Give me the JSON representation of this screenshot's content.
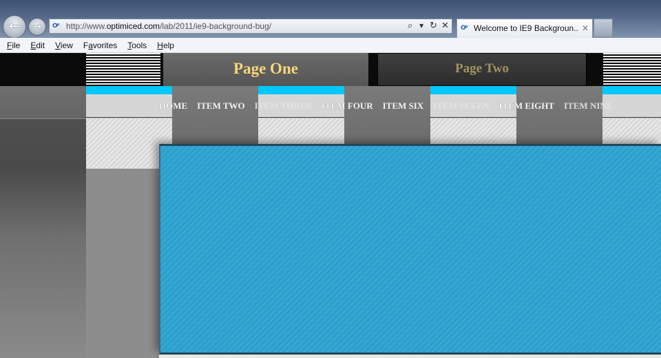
{
  "browser": {
    "address": {
      "prefix": "http://www.",
      "domain": "optimiced.com",
      "path": "/lab/2011/ie9-background-bug/"
    },
    "tab": {
      "title": "Welcome to IE9 Backgroun...",
      "close": "✕"
    },
    "icons": {
      "back": "back-arrow-icon",
      "forward": "forward-arrow-icon",
      "search": "search-icon",
      "refresh": "refresh-icon",
      "stop": "stop-icon",
      "favicon": "ie-page-icon"
    },
    "page_icon_glyph": "O̲",
    "menu": [
      {
        "pre": "",
        "acc": "F",
        "post": "ile"
      },
      {
        "pre": "",
        "acc": "E",
        "post": "dit"
      },
      {
        "pre": "",
        "acc": "V",
        "post": "iew"
      },
      {
        "pre": "F",
        "acc": "a",
        "post": "vorites"
      },
      {
        "pre": "",
        "acc": "T",
        "post": "ools"
      },
      {
        "pre": "",
        "acc": "H",
        "post": "elp"
      }
    ]
  },
  "site": {
    "page_tabs": [
      "Page One",
      "Page Two"
    ],
    "nav": [
      "HOME",
      "ITEM TWO",
      "ITEM THREE",
      "ITEM FOUR",
      "ITEM SIX",
      "ITEM SEVEN",
      "ITEM EIGHT",
      "ITEM NINE"
    ]
  },
  "colors": {
    "accent_cyan": "#00c8ff",
    "content_blue": "#2c9fcc",
    "tab_active_text": "#f7d778",
    "tab_inactive_text": "#a49360"
  }
}
